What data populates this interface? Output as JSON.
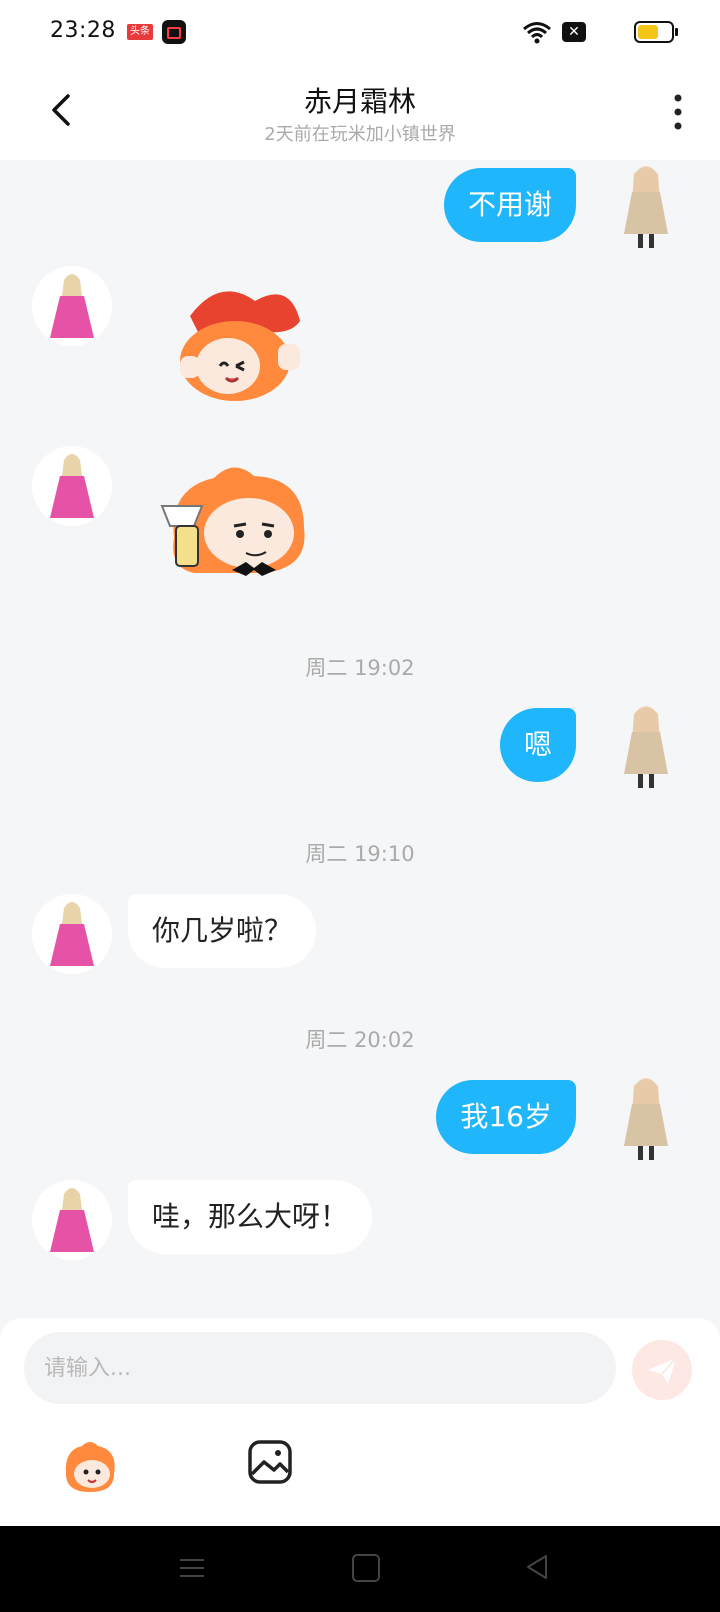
{
  "status_bar": {
    "time": "23:28",
    "toutiao_badge": "头条",
    "sim_icon": "✕",
    "icons": [
      "toutiao-icon",
      "video-record-icon",
      "wifi-icon",
      "sim-off-icon",
      "battery-icon"
    ],
    "battery_color": "#f5c518"
  },
  "header": {
    "title": "赤月霜林",
    "subtitle": "2天前在玩米加小镇世界",
    "back_icon": "chevron-left-icon",
    "more_icon": "more-vertical-icon"
  },
  "messages": [
    {
      "type": "text",
      "side": "out",
      "text": "不用谢"
    },
    {
      "type": "sticker",
      "side": "in",
      "sticker": "orange-mascot-heart-hat-sticker"
    },
    {
      "type": "sticker",
      "side": "in",
      "sticker": "orange-mascot-wine-glass-sticker"
    },
    {
      "type": "time",
      "text": "周二 19:02"
    },
    {
      "type": "text",
      "side": "out",
      "text": "嗯"
    },
    {
      "type": "time",
      "text": "周二 19:10"
    },
    {
      "type": "text",
      "side": "in",
      "text": "你几岁啦？"
    },
    {
      "type": "time",
      "text": "周二 20:02"
    },
    {
      "type": "text",
      "side": "out",
      "text": "我16岁"
    },
    {
      "type": "text",
      "side": "in",
      "text": "哇，那么大呀！"
    }
  ],
  "input": {
    "placeholder": "请输入...",
    "value": ""
  },
  "toolbar": {
    "icons": [
      "emoji-mascot-icon",
      "image-icon",
      "send-icon"
    ]
  },
  "colors": {
    "accent": "#1fb6fb",
    "background": "#f5f6f8",
    "send_button": "#fde8e3"
  },
  "nav_bar": {
    "icons": [
      "menu-icon",
      "home-icon",
      "back-triangle-icon"
    ]
  }
}
